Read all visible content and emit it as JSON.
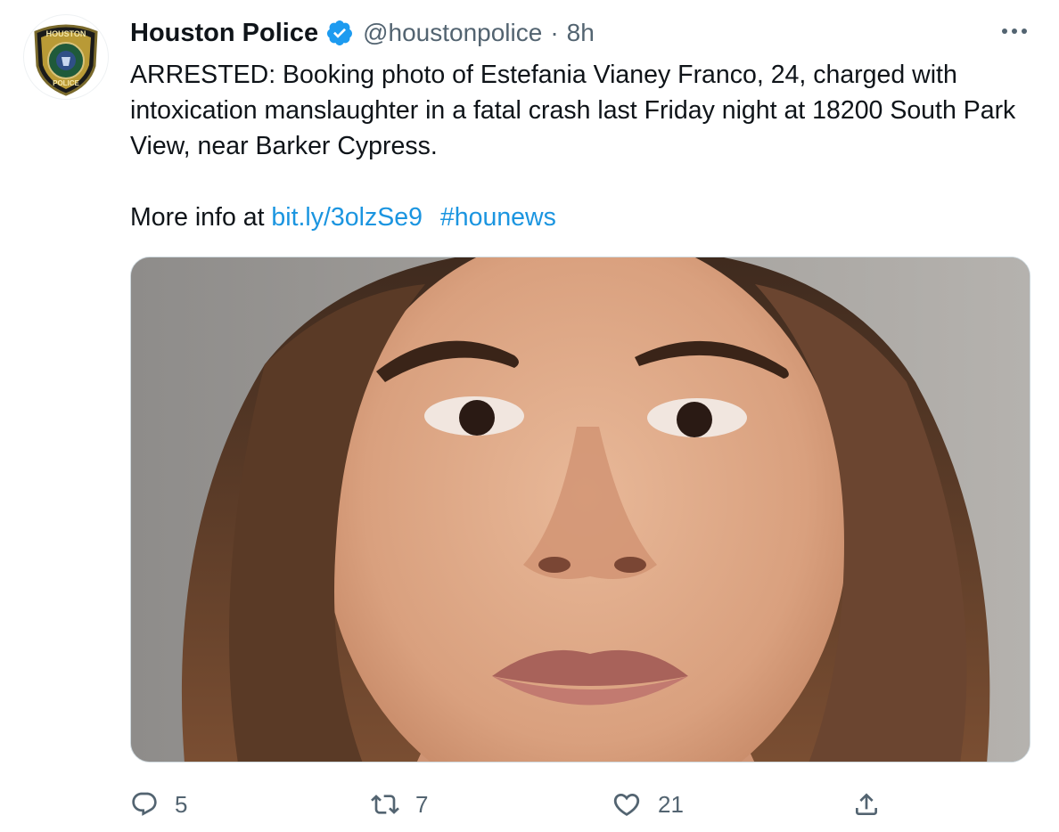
{
  "tweet": {
    "author": {
      "display_name": "Houston Police",
      "handle": "@houstonpolice",
      "separator": "·",
      "timestamp": "8h",
      "verified": true,
      "avatar_logo_text": [
        "HOUSTON",
        "POLICE"
      ]
    },
    "body": {
      "line1": "ARRESTED: Booking photo of Estefania Vianey Franco, 24, charged with intoxication manslaughter in a fatal crash last Friday night at 18200 South Park View, near Barker Cypress.",
      "more_prefix": "More info at ",
      "link_text": "bit.ly/3olzSe9",
      "hashtag": "#hounews"
    },
    "media": {
      "type": "booking-photo"
    },
    "actions": {
      "reply_icon": "reply-icon",
      "reply_count": "5",
      "retweet_icon": "retweet-icon",
      "retweet_count": "7",
      "like_icon": "heart-icon",
      "like_count": "21",
      "share_icon": "share-icon"
    },
    "menu": {
      "icon": "more-horizontal-icon"
    }
  },
  "colors": {
    "text": "#0f1419",
    "secondary": "#536471",
    "link": "#1b95e0",
    "verified": "#1d9bf0",
    "border": "#cfd9de"
  }
}
